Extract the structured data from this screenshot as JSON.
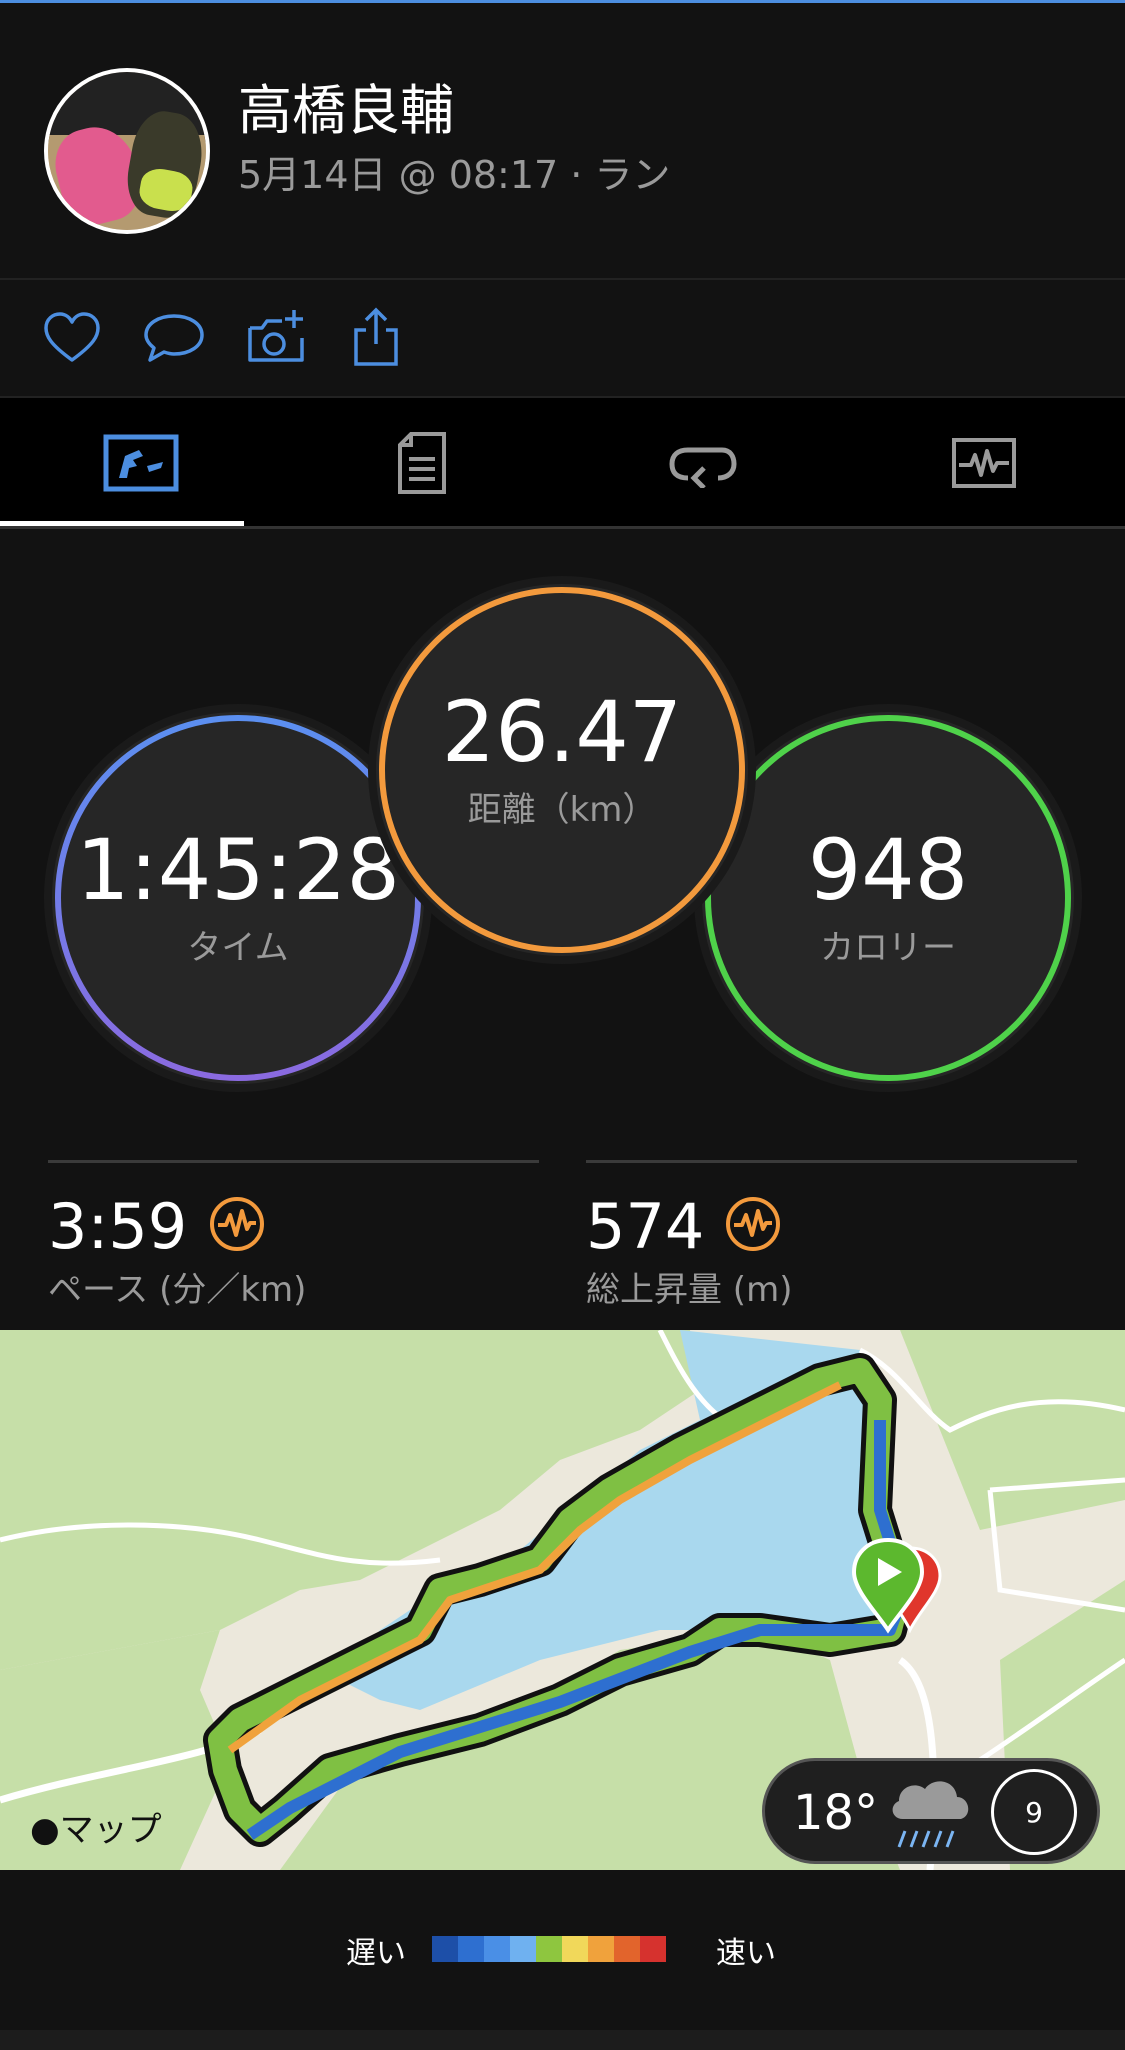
{
  "header": {
    "name": "高橋良輔",
    "subtitle": "5月14日 @ 08:17 · ラン"
  },
  "actions": [
    {
      "icon": "heart-icon"
    },
    {
      "icon": "comment-icon"
    },
    {
      "icon": "add-photo-icon"
    },
    {
      "icon": "share-icon"
    }
  ],
  "tabs": [
    {
      "icon": "overview-icon",
      "selected": true
    },
    {
      "icon": "details-icon",
      "selected": false
    },
    {
      "icon": "laps-icon",
      "selected": false
    },
    {
      "icon": "charts-icon",
      "selected": false
    }
  ],
  "stats": {
    "time": {
      "value": "1:45:28",
      "label": "タイム"
    },
    "distance": {
      "value": "26.47",
      "label": "距離（km）"
    },
    "calories": {
      "value": "948",
      "label": "カロリー"
    }
  },
  "metrics": {
    "pace": {
      "value": "3:59",
      "label": "ペース (分／km)"
    },
    "elevation": {
      "value": "574",
      "label": "総上昇量 (m)"
    }
  },
  "map": {
    "attribution": "マップ",
    "weather": {
      "temp": "18°",
      "condition": "rain-icon",
      "wind": "9"
    }
  },
  "legend": {
    "slow": "遅い",
    "fast": "速い",
    "colors": [
      "#1d4fa8",
      "#2e6fd0",
      "#4a8fe6",
      "#6fb1f0",
      "#8ec63f",
      "#f1d85a",
      "#f0a23c",
      "#e2642c",
      "#d6322e"
    ]
  },
  "colors": {
    "accent": "#4c8ee0",
    "time_ring": "#6a7be8",
    "distance_ring": "#f39a3d",
    "calories_ring": "#4fd24a",
    "metric_icon": "#f39a3d"
  }
}
